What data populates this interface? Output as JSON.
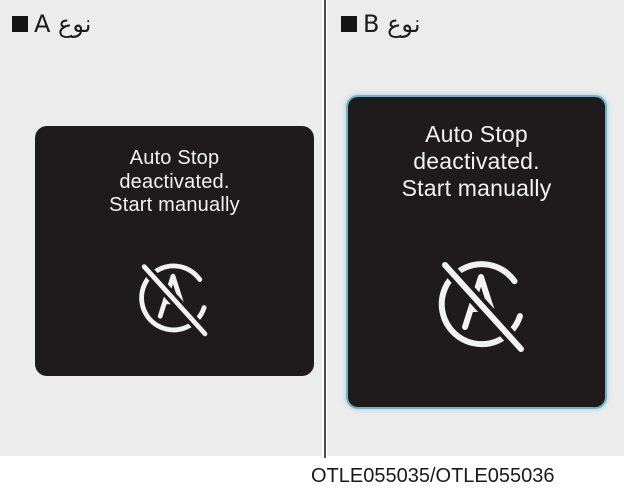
{
  "panel_a": {
    "type_label": "نوع A",
    "screen": {
      "lines": [
        "Auto Stop",
        "deactivated.",
        "Start manually"
      ],
      "icon": "auto-stop-off-icon"
    }
  },
  "panel_b": {
    "type_label": "نوع B",
    "screen": {
      "lines": [
        "Auto Stop",
        "deactivated.",
        "Start manually"
      ],
      "icon": "auto-stop-off-icon"
    }
  },
  "caption": "OTLE055035/OTLE055036",
  "colors": {
    "panel_background": "#ececec",
    "screen_background": "#1f1b1c",
    "screen_text": "#f2f2f2",
    "highlight_border": "#6fb1c9"
  }
}
